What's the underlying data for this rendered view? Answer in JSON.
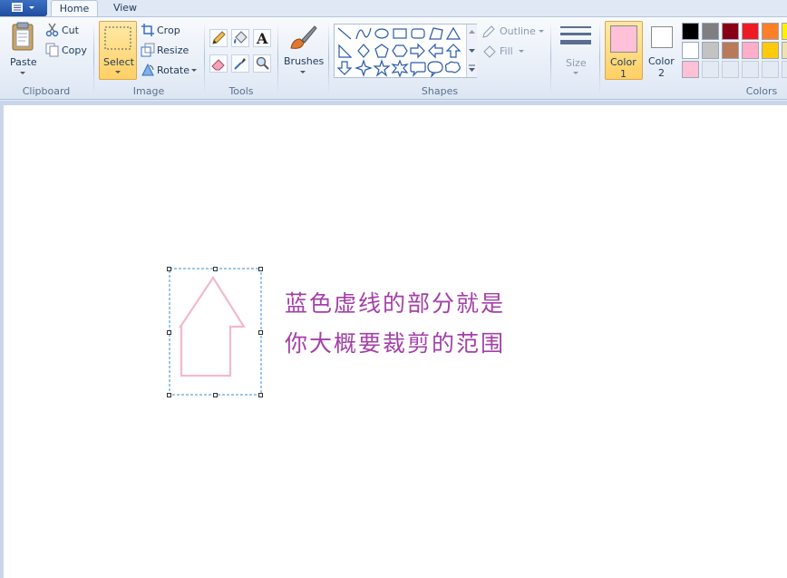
{
  "tabs": {
    "home": "Home",
    "view": "View"
  },
  "clipboard": {
    "paste": "Paste",
    "cut": "Cut",
    "copy": "Copy",
    "group": "Clipboard"
  },
  "image": {
    "select": "Select",
    "crop": "Crop",
    "resize": "Resize",
    "rotate": "Rotate",
    "group": "Image"
  },
  "tools": {
    "group": "Tools",
    "text_glyph": "A"
  },
  "brushes": {
    "label": "Brushes"
  },
  "shapes": {
    "outline": "Outline",
    "fill": "Fill",
    "group": "Shapes"
  },
  "size": {
    "label": "Size"
  },
  "colors": {
    "color1_label": "Color",
    "color1_num": "1",
    "color2_label": "Color",
    "color2_num": "2",
    "group": "Colors",
    "color1_value": "#ffc0d8",
    "color2_value": "#ffffff",
    "palette_row1": [
      "#000000",
      "#7f7f7f",
      "#880015",
      "#ed1c24",
      "#ff7f27",
      "#fff200"
    ],
    "palette_row2": [
      "#ffffff",
      "#c3c3c3",
      "#b97a57",
      "#ffaec9",
      "#ffc90e",
      "#efe4b0"
    ],
    "palette_row3": [
      "#ffc0d8",
      "",
      "",
      "",
      "",
      ""
    ]
  },
  "canvas": {
    "note_line1": "蓝色虚线的部分就是",
    "note_line2": "你大概要裁剪的范围",
    "arrow_color": "#f3b8cf",
    "selection_color": "#3a8fd6",
    "note_color": "#a340a8"
  }
}
